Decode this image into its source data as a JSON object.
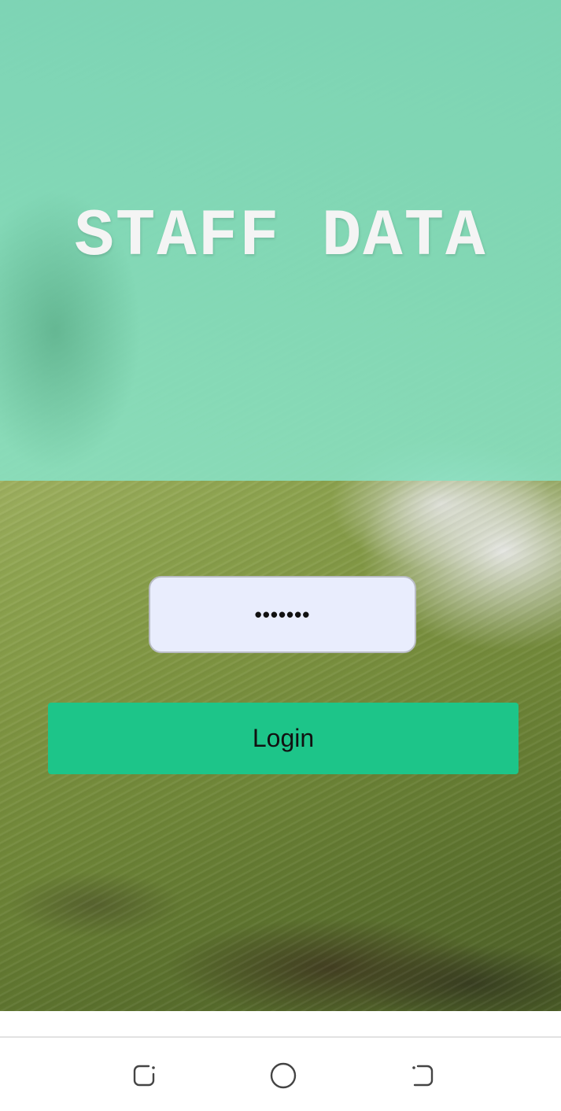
{
  "header": {
    "title": "STAFF DATA"
  },
  "login": {
    "password_value": "•••••••",
    "button_label": "Login"
  },
  "colors": {
    "header_overlay": "#80d9b9",
    "button": "#1dc589",
    "input_background": "#e9edfd"
  },
  "system_nav": {
    "icons": [
      "recent-apps-icon",
      "home-icon",
      "back-icon"
    ]
  }
}
